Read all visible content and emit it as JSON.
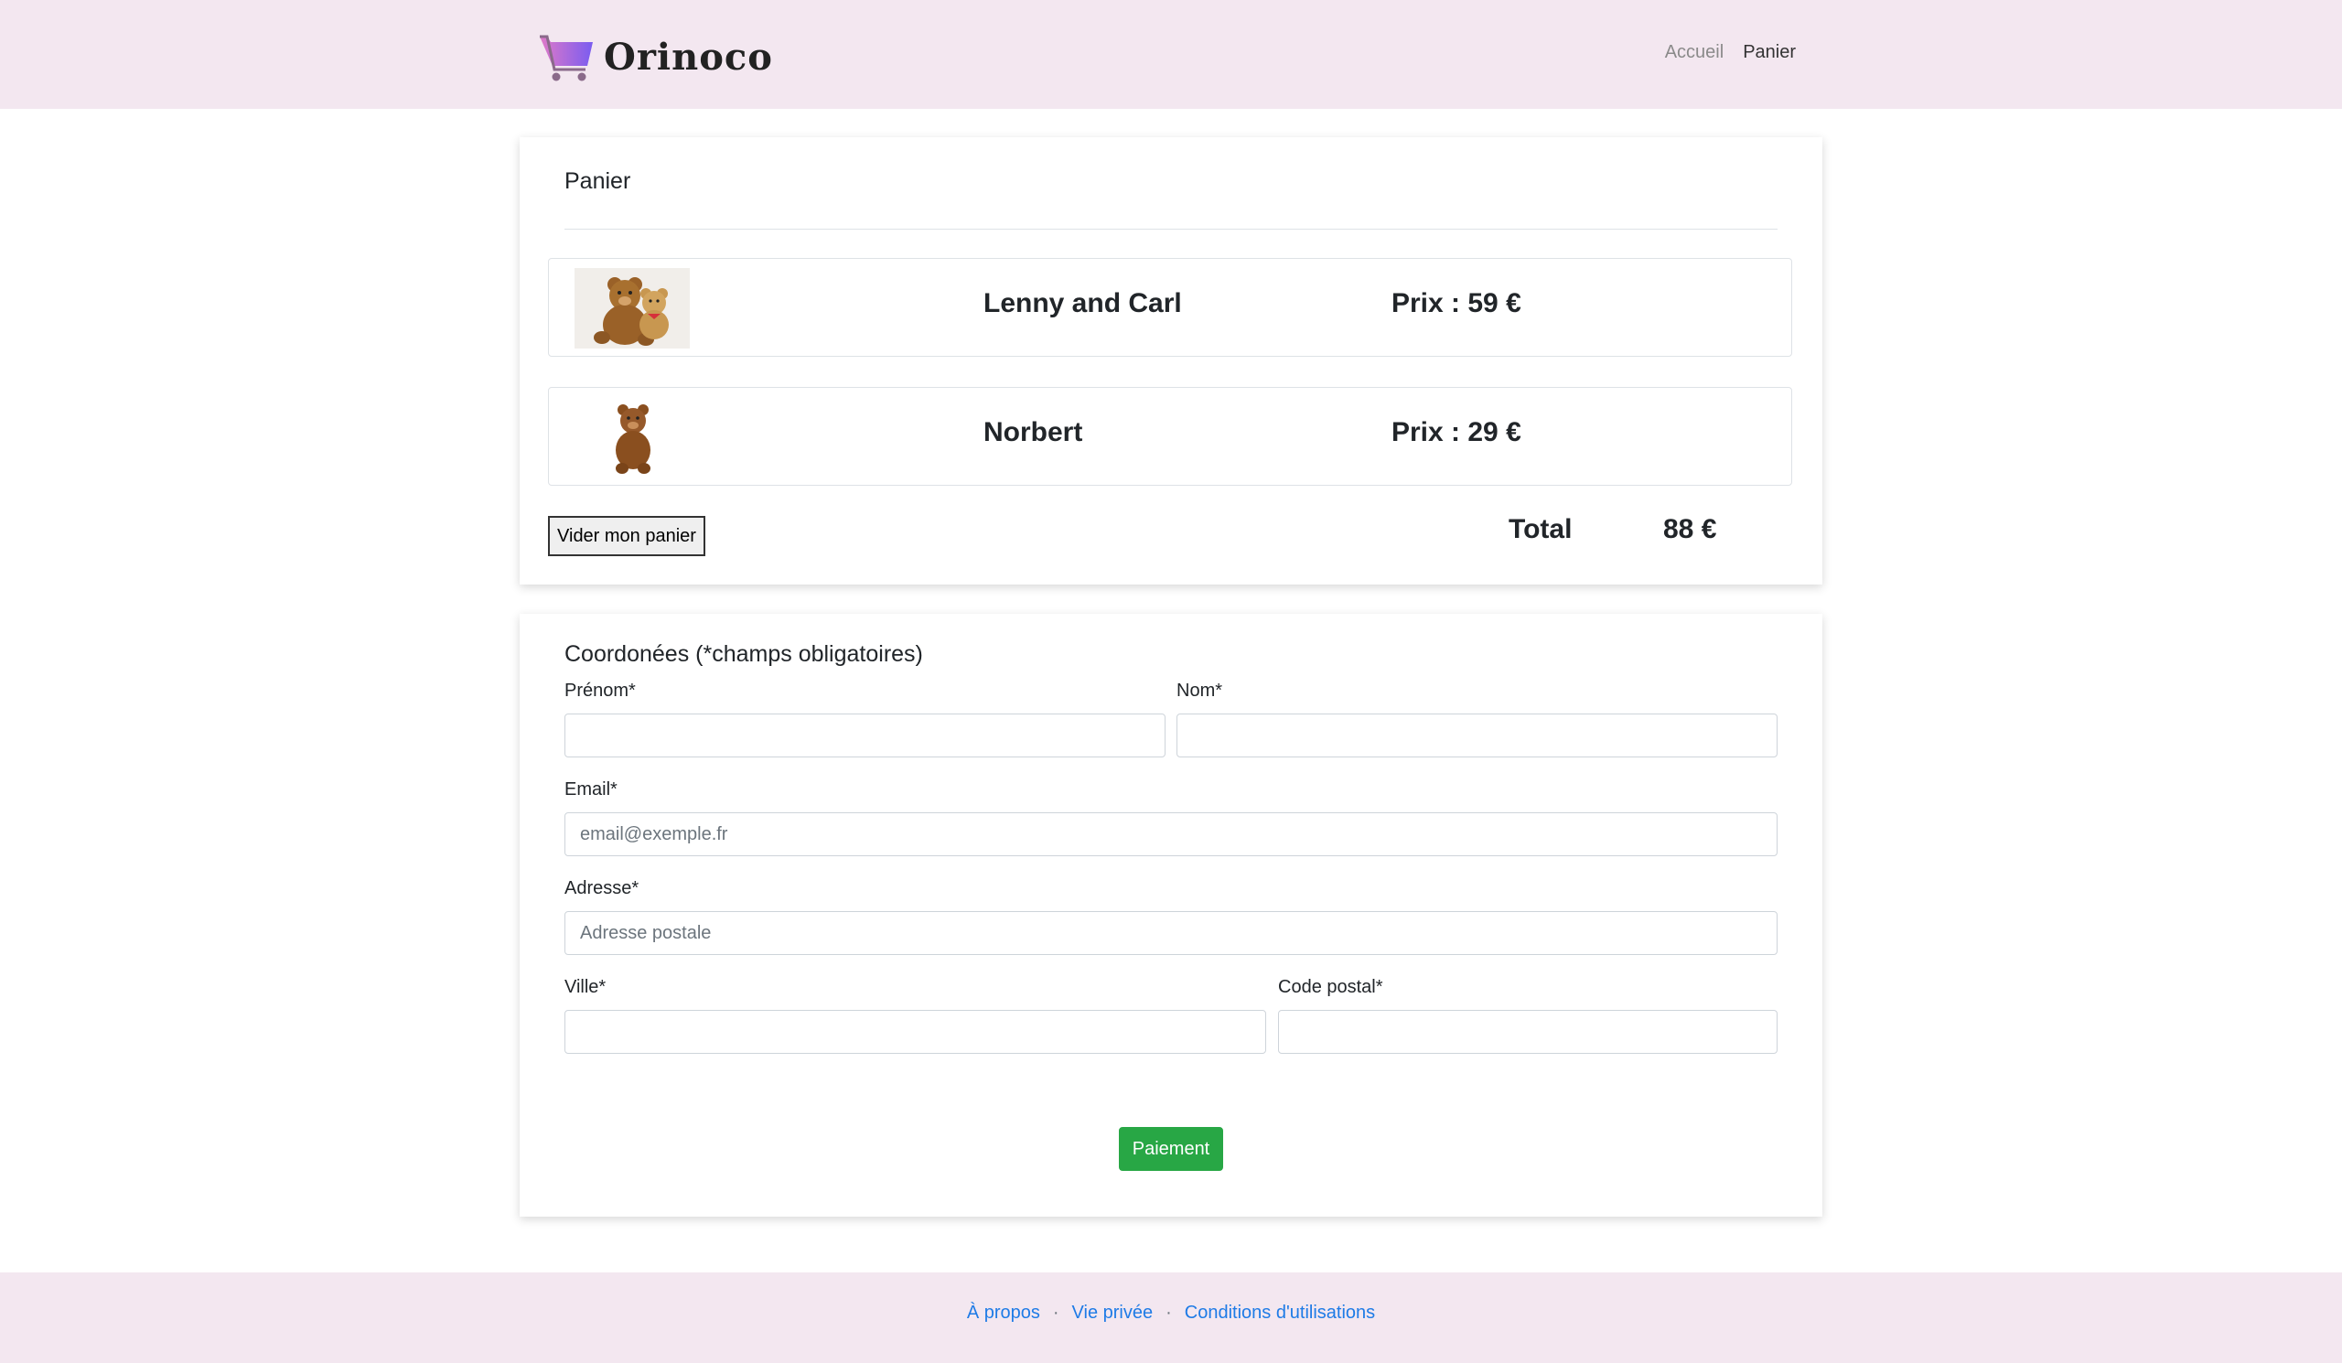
{
  "brand": {
    "name": "Orinoco",
    "logo_icon": "shopping-cart-icon",
    "colors": {
      "cart_from": "#e07ac8",
      "cart_to": "#7a5cf0",
      "cart_wheels": "#8a6a8a"
    }
  },
  "nav": {
    "items": [
      {
        "label": "Accueil",
        "active": false
      },
      {
        "label": "Panier",
        "active": true
      }
    ]
  },
  "cart": {
    "title": "Panier",
    "items": [
      {
        "name": "Lenny and Carl",
        "price": "Prix : 59 €",
        "image_icon": "teddy-bears-pair-photo"
      },
      {
        "name": "Norbert",
        "price": "Prix : 29 €",
        "image_icon": "teddy-bear-photo"
      }
    ],
    "empty_button": "Vider mon panier",
    "total_label": "Total",
    "total_value": "88 €"
  },
  "form": {
    "title": "Coordonées (*champs obligatoires)",
    "firstname": {
      "label": "Prénom*",
      "placeholder": "",
      "value": ""
    },
    "lastname": {
      "label": "Nom*",
      "placeholder": "",
      "value": ""
    },
    "email": {
      "label": "Email*",
      "placeholder": "email@exemple.fr",
      "value": ""
    },
    "address": {
      "label": "Adresse*",
      "placeholder": "Adresse postale",
      "value": ""
    },
    "city": {
      "label": "Ville*",
      "placeholder": "",
      "value": ""
    },
    "postal": {
      "label": "Code postal*",
      "placeholder": "",
      "value": ""
    },
    "submit": "Paiement",
    "submit_color": "#28a745"
  },
  "footer": {
    "links": [
      "À propos",
      "Vie privée",
      "Conditions d'utilisations"
    ],
    "separator": "·",
    "link_color": "#1e7be6"
  },
  "theme": {
    "band_color": "#f3e7f0"
  }
}
